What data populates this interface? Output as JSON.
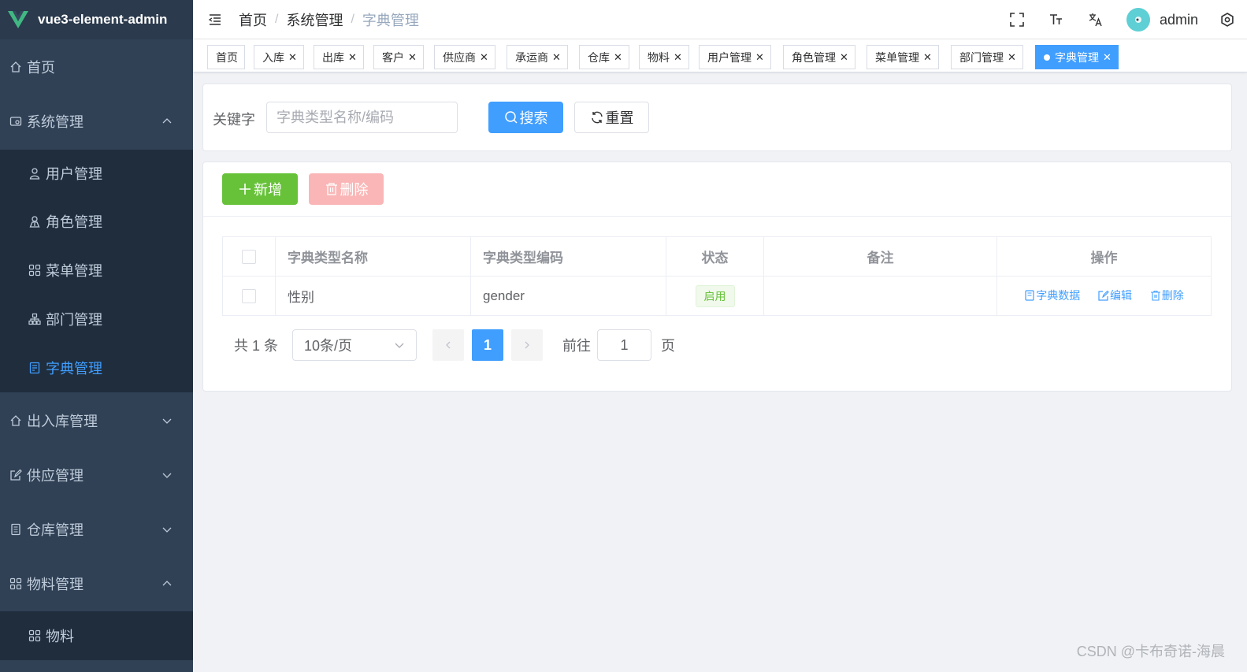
{
  "app": {
    "title": "vue3-element-admin"
  },
  "colors": {
    "primary": "#409eff",
    "success": "#67c23a",
    "danger_light": "#fab6b6",
    "sidebar": "#304156"
  },
  "sidebar": {
    "items": [
      {
        "label": "首页",
        "icon": "home-icon"
      },
      {
        "label": "系统管理",
        "icon": "system-icon",
        "expanded": true
      },
      {
        "label": "用户管理",
        "icon": "user-icon"
      },
      {
        "label": "角色管理",
        "icon": "role-icon"
      },
      {
        "label": "菜单管理",
        "icon": "menu-grid-icon"
      },
      {
        "label": "部门管理",
        "icon": "org-tree-icon"
      },
      {
        "label": "字典管理",
        "icon": "dictionary-icon",
        "active": true
      },
      {
        "label": "出入库管理",
        "icon": "home-icon",
        "expanded": false
      },
      {
        "label": "供应管理",
        "icon": "edit-icon",
        "expanded": false
      },
      {
        "label": "仓库管理",
        "icon": "document-icon",
        "expanded": false
      },
      {
        "label": "物料管理",
        "icon": "menu-grid-icon",
        "expanded": true
      },
      {
        "label": "物料",
        "icon": "menu-grid-icon"
      }
    ]
  },
  "header": {
    "breadcrumb": [
      "首页",
      "系统管理",
      "字典管理"
    ],
    "breadcrumb_sep": "/",
    "username": "admin",
    "icons": [
      "fullscreen-icon",
      "font-size-icon",
      "translate-icon",
      "settings-icon"
    ]
  },
  "tags": [
    {
      "label": "首页",
      "closable": false
    },
    {
      "label": "入库",
      "closable": true
    },
    {
      "label": "出库",
      "closable": true
    },
    {
      "label": "客户",
      "closable": true
    },
    {
      "label": "供应商",
      "closable": true
    },
    {
      "label": "承运商",
      "closable": true
    },
    {
      "label": "仓库",
      "closable": true
    },
    {
      "label": "物料",
      "closable": true
    },
    {
      "label": "用户管理",
      "closable": true
    },
    {
      "label": "角色管理",
      "closable": true
    },
    {
      "label": "菜单管理",
      "closable": true
    },
    {
      "label": "部门管理",
      "closable": true
    },
    {
      "label": "字典管理",
      "closable": true,
      "active": true
    }
  ],
  "search": {
    "label": "关键字",
    "placeholder": "字典类型名称/编码",
    "search_button": "搜索",
    "reset_button": "重置"
  },
  "toolbar": {
    "add_button": "新增",
    "delete_button": "删除"
  },
  "table": {
    "columns": [
      "字典类型名称",
      "字典类型编码",
      "状态",
      "备注",
      "操作"
    ],
    "rows": [
      {
        "name": "性别",
        "code": "gender",
        "status": "启用",
        "remark": "",
        "actions": [
          "字典数据",
          "编辑",
          "删除"
        ]
      }
    ]
  },
  "pagination": {
    "total_text": "共 1 条",
    "page_size": "10条/页",
    "current_page": "1",
    "goto_label": "前往",
    "goto_value": "1",
    "page_suffix": "页"
  },
  "watermark": "CSDN @卡布奇诺-海晨",
  "close_glyph": "✕"
}
